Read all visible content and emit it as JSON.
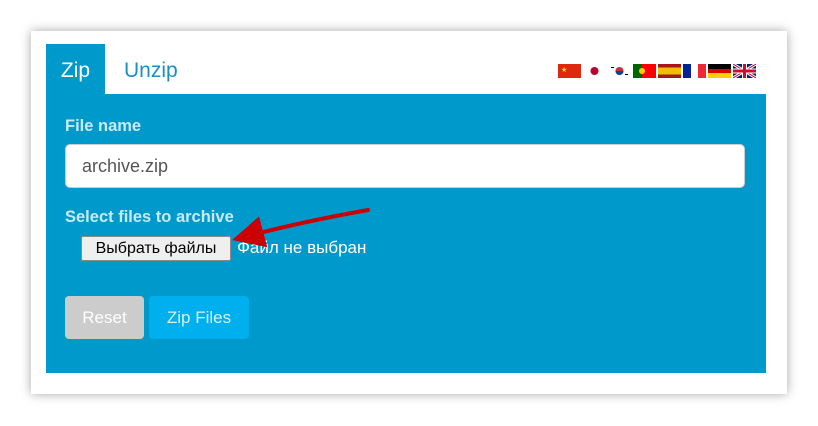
{
  "tabs": [
    {
      "label": "Zip",
      "active": true
    },
    {
      "label": "Unzip",
      "active": false
    }
  ],
  "languages": [
    {
      "name": "chinese-flag-icon",
      "code": "zh"
    },
    {
      "name": "japanese-flag-icon",
      "code": "ja"
    },
    {
      "name": "korean-flag-icon",
      "code": "ko"
    },
    {
      "name": "portuguese-flag-icon",
      "code": "pt"
    },
    {
      "name": "spanish-flag-icon",
      "code": "es"
    },
    {
      "name": "french-flag-icon",
      "code": "fr"
    },
    {
      "name": "german-flag-icon",
      "code": "de"
    },
    {
      "name": "english-flag-icon",
      "code": "en"
    }
  ],
  "form": {
    "file_name_label": "File name",
    "file_name_value": "archive.zip",
    "select_label": "Select files to archive",
    "choose_button": "Выбрать файлы",
    "no_file_text": "Файл не выбран",
    "reset_button": "Reset",
    "zip_button": "Zip Files"
  },
  "colors": {
    "panel": "#0099cc",
    "tab_text": "#1a8fc4",
    "zip_button": "#00b0ee",
    "reset_button": "#cccccc",
    "annotation_arrow": "#cc0000"
  }
}
